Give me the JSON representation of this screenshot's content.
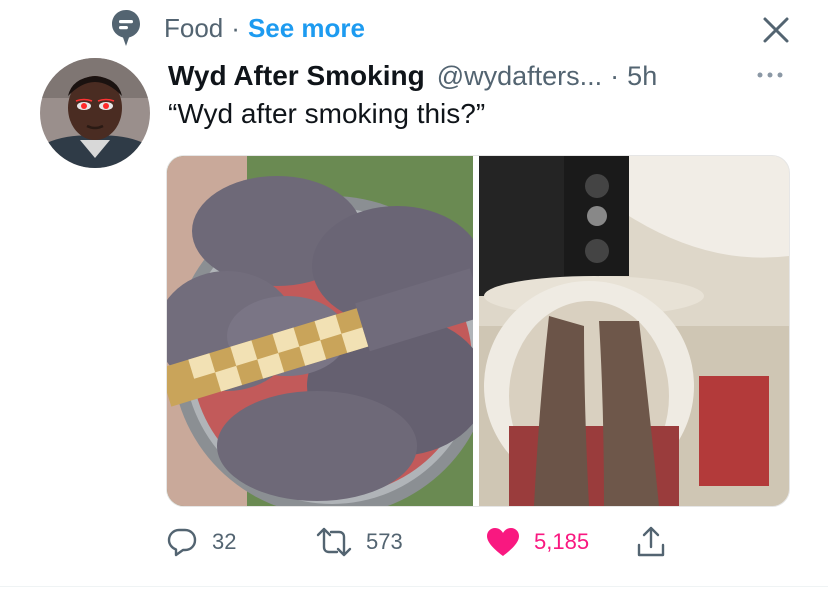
{
  "topic": {
    "label": "Food",
    "dot": "·",
    "see_more": "See more",
    "icon": "topic-icon"
  },
  "tweet": {
    "display_name": "Wyd After Smoking",
    "handle": "@wydafters...",
    "separator": "·",
    "time": "5h",
    "text": "“Wyd after smoking this?”"
  },
  "actions": {
    "replies": "32",
    "retweets": "573",
    "likes": "5,185",
    "liked": true
  },
  "colors": {
    "accent": "#1d9bf0",
    "secondary_text": "#536471",
    "like": "#f91880"
  },
  "icons": [
    "topic-icon",
    "close-icon",
    "more-icon",
    "reply-icon",
    "retweet-icon",
    "heart-icon",
    "share-icon"
  ]
}
